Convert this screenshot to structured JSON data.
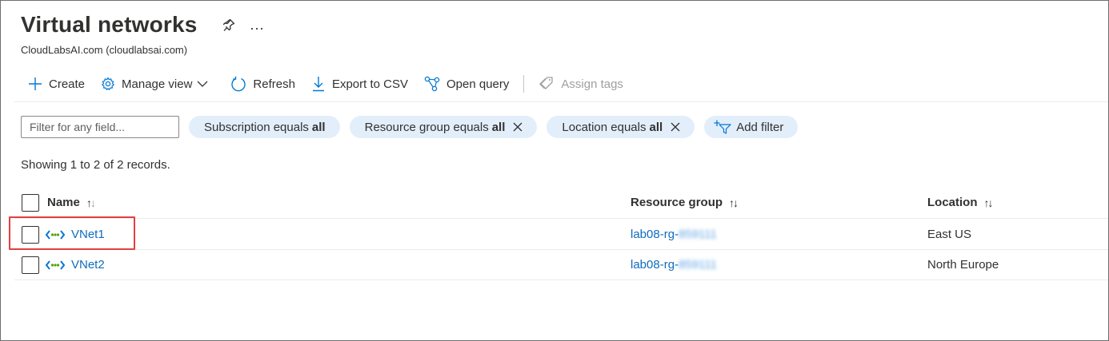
{
  "header": {
    "title": "Virtual networks",
    "subtitle": "CloudLabsAI.com (cloudlabsai.com)",
    "more_label": "..."
  },
  "toolbar": {
    "create": "Create",
    "manage_view": "Manage view",
    "refresh": "Refresh",
    "export_csv": "Export to CSV",
    "open_query": "Open query",
    "assign_tags": "Assign tags"
  },
  "filters": {
    "input_placeholder": "Filter for any field...",
    "pills": [
      {
        "label": "Subscription equals",
        "value": "all",
        "removable": false
      },
      {
        "label": "Resource group equals",
        "value": "all",
        "removable": true
      },
      {
        "label": "Location equals",
        "value": "all",
        "removable": true
      }
    ],
    "add_filter": "Add filter"
  },
  "records_text": "Showing 1 to 2 of 2 records.",
  "table": {
    "columns": [
      "Name",
      "Resource group",
      "Location"
    ],
    "rows": [
      {
        "name": "VNet1",
        "rg_prefix": "lab08-rg-",
        "rg_redacted": "859111",
        "location": "East US"
      },
      {
        "name": "VNet2",
        "rg_prefix": "lab08-rg-",
        "rg_redacted": "859111",
        "location": "North Europe"
      }
    ]
  },
  "colors": {
    "link": "#0f6cbd",
    "pill_bg": "#e3eefb",
    "highlight": "#e3403f",
    "icon_blue": "#0078d4",
    "icon_green": "#57a300"
  }
}
